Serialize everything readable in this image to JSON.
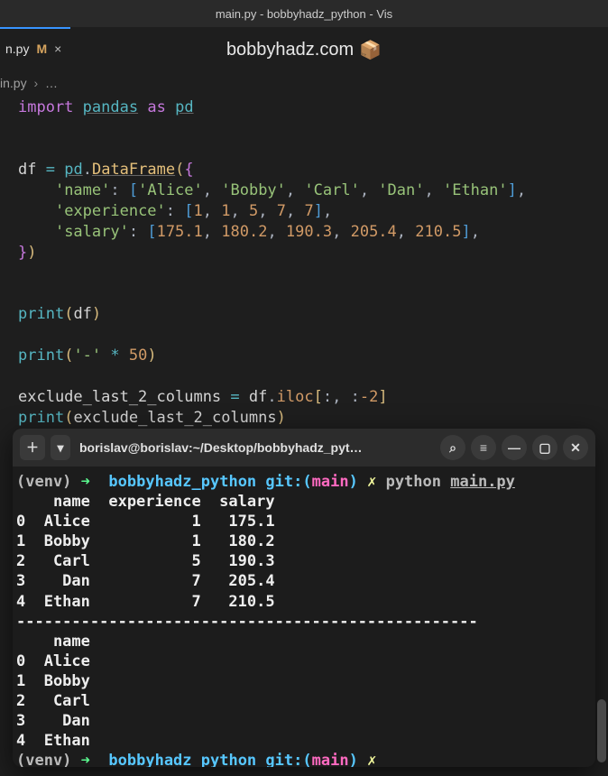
{
  "window": {
    "title": "main.py - bobbyhadz_python - Vis"
  },
  "site": {
    "name": "bobbyhadz.com",
    "icon": "📦"
  },
  "tab": {
    "filename": "n.py",
    "modified_indicator": "M",
    "close_glyph": "×"
  },
  "breadcrumb": {
    "file": "in.py",
    "sep": "›",
    "rest": "…"
  },
  "code": {
    "import_kw": "import",
    "pandas": "pandas",
    "as_kw": "as",
    "pd": "pd",
    "df_var": "df",
    "eq": "=",
    "pd_ref": "pd",
    "dot": ".",
    "dataframe": "DataFrame",
    "name_key": "'name'",
    "names": [
      "'Alice'",
      "'Bobby'",
      "'Carl'",
      "'Dan'",
      "'Ethan'"
    ],
    "exp_key": "'experience'",
    "exp_vals": [
      "1",
      "1",
      "5",
      "7",
      "7"
    ],
    "sal_key": "'salary'",
    "sal_vals": [
      "175.1",
      "180.2",
      "190.3",
      "205.4",
      "210.5"
    ],
    "print_fn": "print",
    "sep_str": "'-'",
    "mul": "*",
    "fifty": "50",
    "excl_var": "exclude_last_2_columns",
    "iloc": "iloc",
    "colon": ":",
    "neg2": "-2"
  },
  "terminal": {
    "titlebar": "borislav@borislav:~/Desktop/bobbyhadz_pyt…",
    "icons": {
      "newtab": "＋",
      "dropdown": "▾",
      "search": "⌕",
      "menu": "≡",
      "minimize": "—",
      "maximize": "▢",
      "close": "✕"
    },
    "prompt1": {
      "venv": "(venv)",
      "arrow": "➜",
      "path": "bobbyhadz_python",
      "git_label": "git:",
      "branch": "main",
      "dirty": "✗",
      "cmd": "python",
      "file": "main.py"
    },
    "output_header": "    name  experience  salary",
    "output_rows": [
      "0  Alice           1   175.1",
      "1  Bobby           1   180.2",
      "2   Carl           5   190.3",
      "3    Dan           7   205.4",
      "4  Ethan           7   210.5"
    ],
    "separator": "--------------------------------------------------",
    "output2_header": "    name",
    "output2_rows": [
      "0  Alice",
      "1  Bobby",
      "2   Carl",
      "3    Dan",
      "4  Ethan"
    ]
  }
}
